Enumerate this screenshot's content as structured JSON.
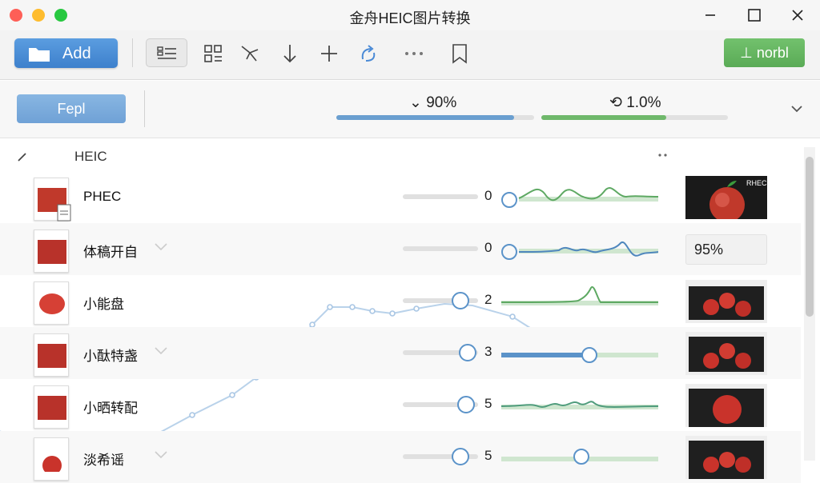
{
  "window": {
    "title": "金舟HEIC图片转换"
  },
  "toolbar": {
    "add_label": "Add",
    "green_label": "⊥ norbl"
  },
  "subbar": {
    "left_label": "Fepl",
    "progress_a": {
      "label": "⌄ 90%",
      "value": 0.9,
      "color": "#6a9fd0"
    },
    "progress_b": {
      "label": "⟲ 1.0%",
      "value": 0.67,
      "color": "#6fb86b"
    }
  },
  "list": {
    "header_label": "HEIC",
    "rows": [
      {
        "name": "PHEC",
        "count": "0",
        "preview": "image",
        "preview_label": "RHEC"
      },
      {
        "name": "体稿开自",
        "count": "0",
        "preview": "percent",
        "percent": "95%"
      },
      {
        "name": "小能盘",
        "count": "2",
        "preview": "image"
      },
      {
        "name": "小酞特盏",
        "count": "3",
        "preview": "image"
      },
      {
        "name": "小晒转配",
        "count": "5",
        "preview": "image"
      },
      {
        "name": "淡希谣",
        "count": "5",
        "preview": "image"
      }
    ]
  },
  "colors": {
    "accent_blue": "#4a8ad6",
    "accent_green": "#6ab865"
  },
  "icons": [
    "folder-icon",
    "list-view-icon",
    "grid-view-icon",
    "crop-icon",
    "download-icon",
    "plus-icon",
    "rotate-icon",
    "more-icon",
    "bookmark-icon",
    "chevron-down-icon",
    "minimize-icon",
    "maximize-icon",
    "close-icon",
    "edit-icon"
  ]
}
